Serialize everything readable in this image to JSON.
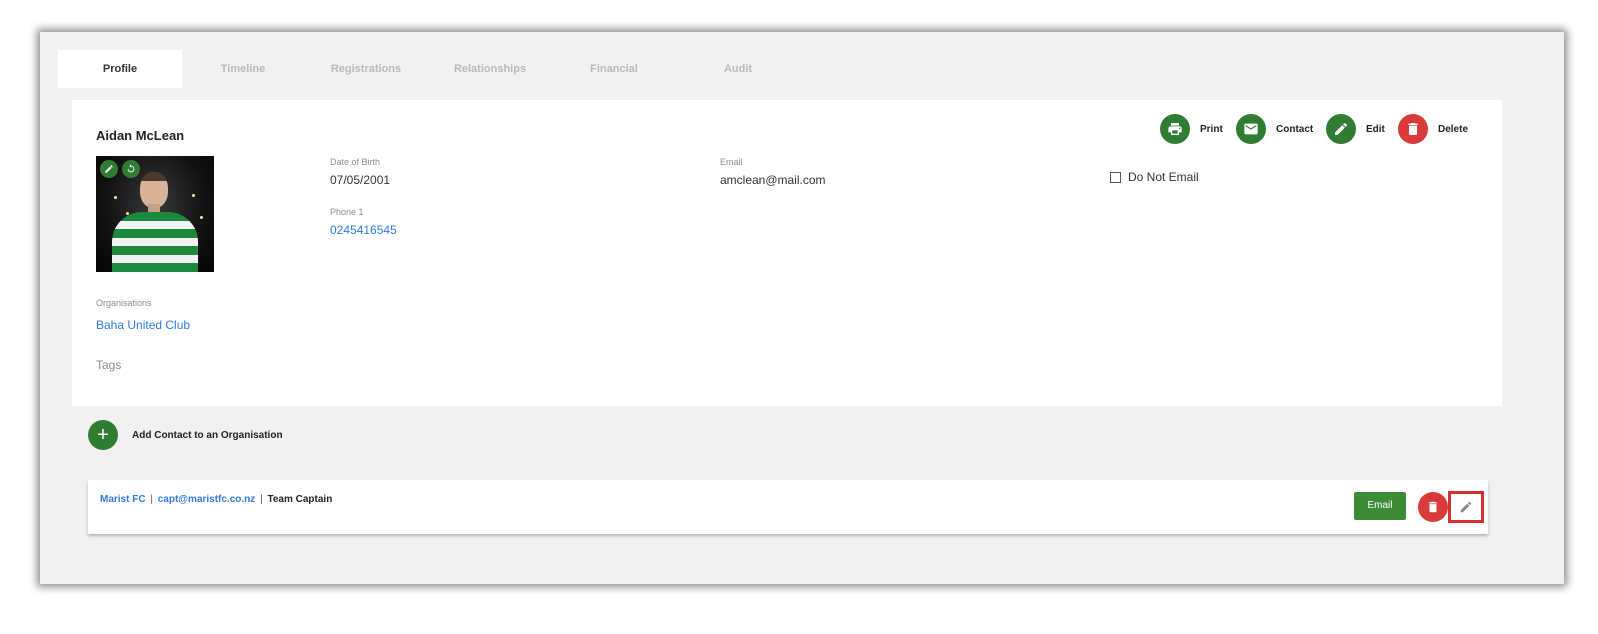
{
  "tabs": [
    {
      "label": "Profile"
    },
    {
      "label": "Timeline"
    },
    {
      "label": "Registrations"
    },
    {
      "label": "Relationships"
    },
    {
      "label": "Financial"
    },
    {
      "label": "Audit"
    }
  ],
  "profile": {
    "name": "Aidan McLean",
    "dob_label": "Date of Birth",
    "dob": "07/05/2001",
    "phone_label": "Phone 1",
    "phone": "0245416545",
    "email_label": "Email",
    "email": "amclean@mail.com",
    "do_not_email_label": "Do Not Email",
    "do_not_email_checked": false,
    "organisations_label": "Organisations",
    "organisation": "Baha United Club",
    "tags_label": "Tags"
  },
  "actions": {
    "print": "Print",
    "contact": "Contact",
    "edit": "Edit",
    "delete": "Delete"
  },
  "add_contact": {
    "label": "Add Contact to an Organisation"
  },
  "relationship": {
    "org": "Marist FC",
    "email": "capt@maristfc.co.nz",
    "role": "Team Captain",
    "separator": "|",
    "email_button": "Email"
  },
  "colors": {
    "accent_green": "#2e7d32",
    "danger_red": "#d93a3a",
    "link_blue": "#2f7be0",
    "highlight_border": "#d32f2f"
  },
  "icons": [
    "print-icon",
    "mail-icon",
    "pencil-icon",
    "trash-icon",
    "plus-icon",
    "refresh-icon"
  ]
}
